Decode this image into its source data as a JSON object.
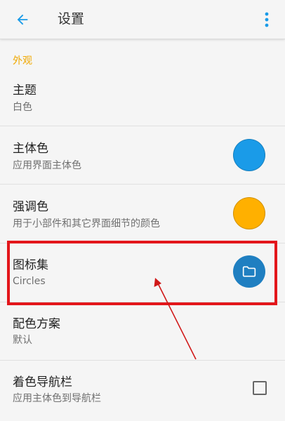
{
  "appbar": {
    "title": "设置",
    "back_icon": "arrow-left-icon",
    "more_icon": "more-vertical-icon"
  },
  "section": {
    "label": "外观",
    "color": "#f0a800"
  },
  "rows": [
    {
      "title": "主题",
      "subtitle": "白色"
    },
    {
      "title": "主体色",
      "subtitle": "应用界面主体色",
      "swatch": "#1a9be8"
    },
    {
      "title": "强调色",
      "subtitle": "用于小部件和其它界面细节的颜色",
      "swatch": "#ffb000"
    },
    {
      "title": "图标集",
      "subtitle": "Circles",
      "icon": "folder-icon",
      "icon_bg": "#1f7fc1"
    },
    {
      "title": "配色方案",
      "subtitle": "默认"
    },
    {
      "title": "着色导航栏",
      "subtitle": "应用主体色到导航栏",
      "checked": false
    }
  ],
  "colors": {
    "accent_blue": "#1a9be8",
    "highlight_red": "#e3161b"
  }
}
